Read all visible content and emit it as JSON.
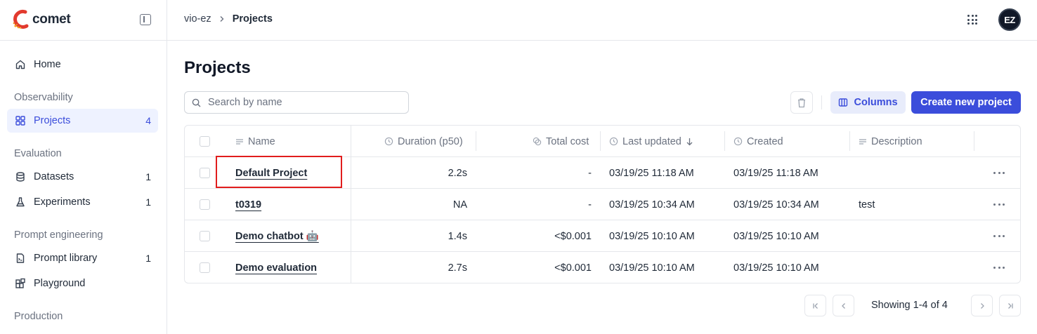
{
  "brand": {
    "name": "comet"
  },
  "sidebar": {
    "home": "Home",
    "sections": {
      "observability": "Observability",
      "evaluation": "Evaluation",
      "prompt_engineering": "Prompt engineering",
      "production": "Production"
    },
    "items": [
      {
        "label": "Projects",
        "count": "4",
        "icon": "grid-icon",
        "active": true
      },
      {
        "label": "Datasets",
        "count": "1",
        "icon": "database-icon"
      },
      {
        "label": "Experiments",
        "count": "1",
        "icon": "flask-icon"
      },
      {
        "label": "Prompt library",
        "count": "1",
        "icon": "file-text-icon"
      },
      {
        "label": "Playground",
        "count": "",
        "icon": "blocks-icon"
      }
    ]
  },
  "topbar": {
    "workspace": "vio-ez",
    "separator": ">",
    "current": "Projects",
    "avatar_initials": "EZ"
  },
  "main": {
    "title": "Projects",
    "search_placeholder": "Search by name",
    "columns_button": "Columns",
    "create_button": "Create new project"
  },
  "table": {
    "headers": {
      "name": "Name",
      "duration": "Duration (p50)",
      "cost": "Total cost",
      "last_updated": "Last updated",
      "created": "Created",
      "description": "Description"
    },
    "rows": [
      {
        "name": "Default Project",
        "duration": "2.2s",
        "cost": "-",
        "last_updated": "03/19/25 11:18 AM",
        "created": "03/19/25 11:18 AM",
        "description": ""
      },
      {
        "name": "t0319",
        "duration": "NA",
        "cost": "-",
        "last_updated": "03/19/25 10:34 AM",
        "created": "03/19/25 10:34 AM",
        "description": "test"
      },
      {
        "name": "Demo chatbot 🤖",
        "duration": "1.4s",
        "cost": "<$0.001",
        "last_updated": "03/19/25 10:10 AM",
        "created": "03/19/25 10:10 AM",
        "description": ""
      },
      {
        "name": "Demo evaluation",
        "duration": "2.7s",
        "cost": "<$0.001",
        "last_updated": "03/19/25 10:10 AM",
        "created": "03/19/25 10:10 AM",
        "description": ""
      }
    ]
  },
  "pagination": {
    "text": "Showing 1-4 of 4"
  },
  "colors": {
    "accent": "#3b4ddb",
    "highlight": "#e11d1d"
  }
}
